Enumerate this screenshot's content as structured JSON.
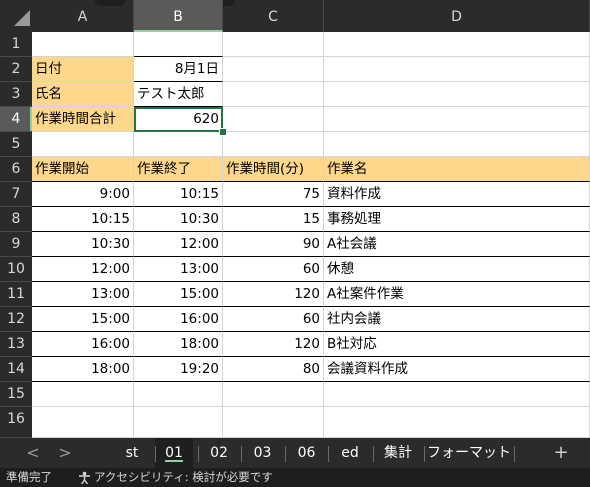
{
  "columns": [
    "A",
    "B",
    "C",
    "D"
  ],
  "selected_column": "B",
  "rows": [
    "1",
    "2",
    "3",
    "4",
    "5",
    "6",
    "7",
    "8",
    "9",
    "10",
    "11",
    "12",
    "13",
    "14",
    "15",
    "16"
  ],
  "selected_row": "4",
  "info": {
    "date_label": "日付",
    "date_value": "8月1日",
    "name_label": "氏名",
    "name_value": "テスト太郎",
    "total_label": "作業時間合計",
    "total_value": "620"
  },
  "table": {
    "headers": [
      "作業開始",
      "作業終了",
      "作業時間(分)",
      "作業名"
    ],
    "rows": [
      [
        "9:00",
        "10:15",
        "75",
        "資料作成"
      ],
      [
        "10:15",
        "10:30",
        "15",
        "事務処理"
      ],
      [
        "10:30",
        "12:00",
        "90",
        "A社会議"
      ],
      [
        "12:00",
        "13:00",
        "60",
        "休憩"
      ],
      [
        "13:00",
        "15:00",
        "120",
        "A社案件作業"
      ],
      [
        "15:00",
        "16:00",
        "60",
        "社内会議"
      ],
      [
        "16:00",
        "18:00",
        "120",
        "B社対応"
      ],
      [
        "18:00",
        "19:20",
        "80",
        "会議資料作成"
      ]
    ]
  },
  "sheet_tabs": {
    "prev": "<",
    "next": ">",
    "items": [
      "st",
      "01",
      "02",
      "03",
      "06",
      "ed",
      "集計",
      "フォーマット"
    ],
    "active": "01",
    "add": "+"
  },
  "status": {
    "ready": "準備完了",
    "accessibility": "アクセシビリティ: 検討が必要です"
  },
  "colors": {
    "header_fill": "#fcd78c",
    "selection": "#217346",
    "chrome": "#2b2b2b"
  }
}
